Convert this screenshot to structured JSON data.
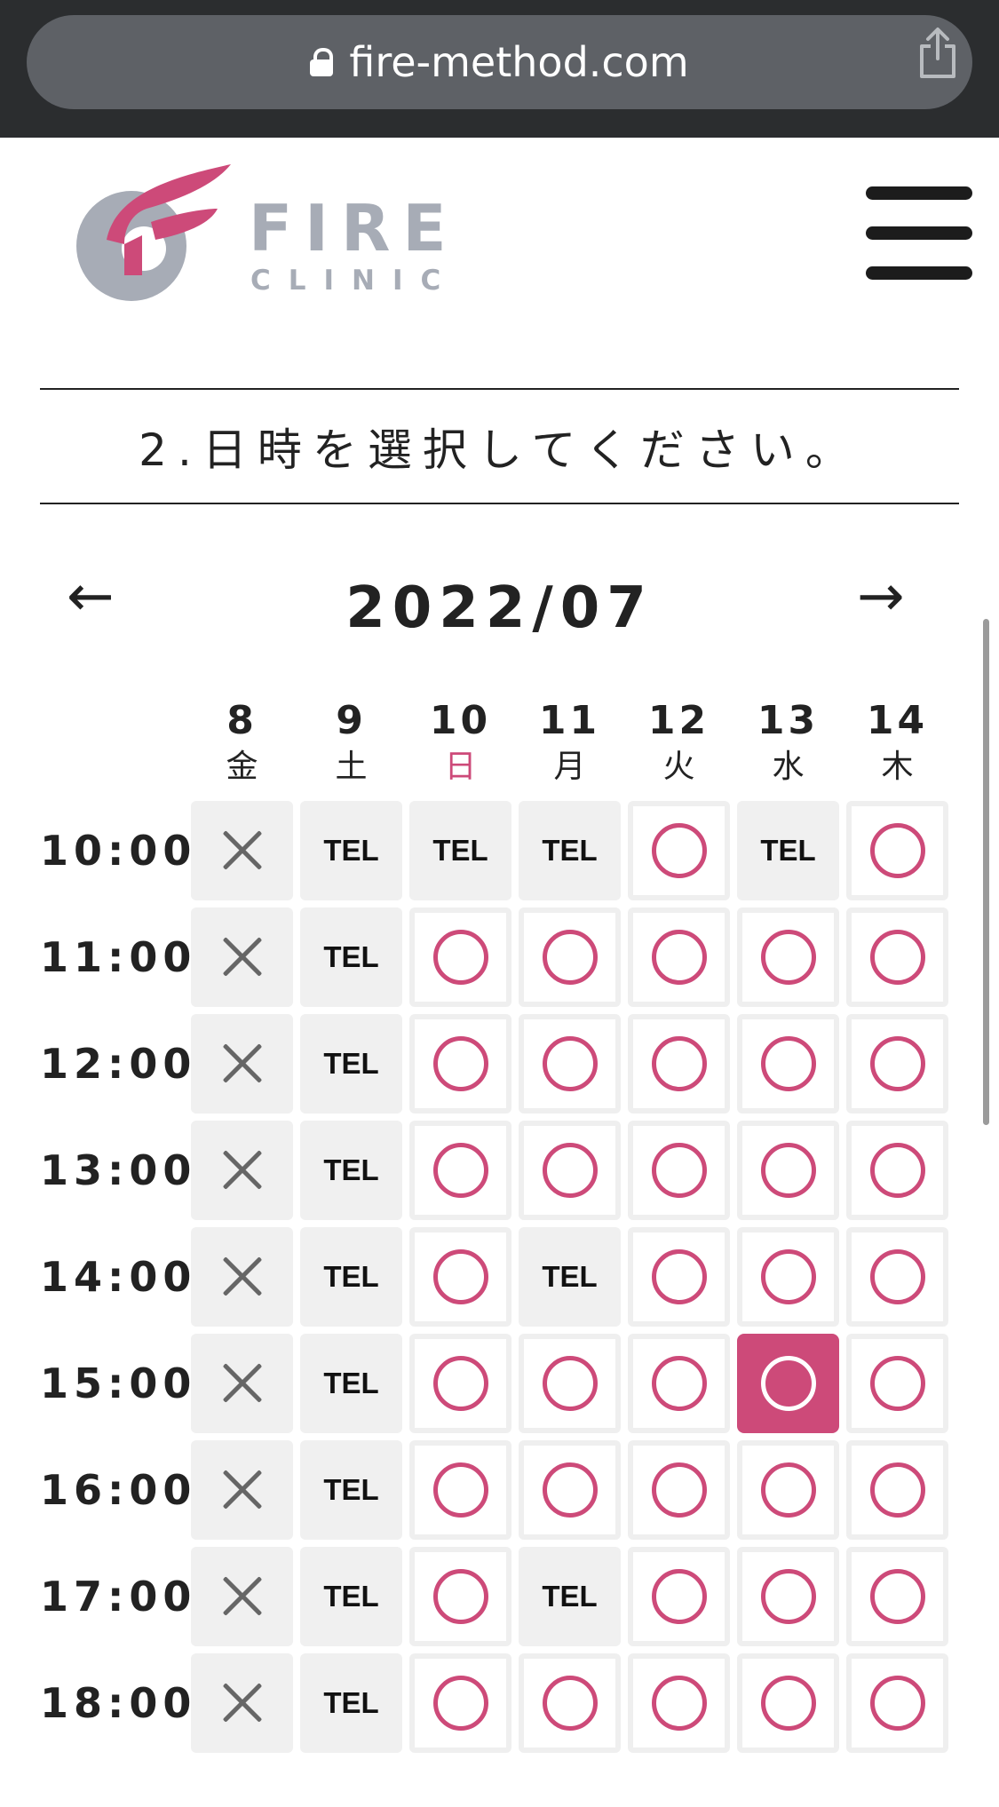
{
  "browser": {
    "url": "fire-method.com"
  },
  "logo": {
    "line1": "FIRE",
    "line2": "CLINIC",
    "brand_color": "#cd4a79",
    "gray_color": "#a7acb6"
  },
  "section": {
    "title": "2.日時を選択してください。"
  },
  "calendar": {
    "month": "2022/07",
    "prev_label": "←",
    "next_label": "→",
    "days": [
      {
        "num": "8",
        "weekday": "金",
        "color": "#222222"
      },
      {
        "num": "9",
        "weekday": "土",
        "color": "#222222"
      },
      {
        "num": "10",
        "weekday": "日",
        "color": "#cd4a79"
      },
      {
        "num": "11",
        "weekday": "月",
        "color": "#222222"
      },
      {
        "num": "12",
        "weekday": "火",
        "color": "#222222"
      },
      {
        "num": "13",
        "weekday": "水",
        "color": "#222222"
      },
      {
        "num": "14",
        "weekday": "木",
        "color": "#222222"
      }
    ],
    "times": [
      "10:00",
      "11:00",
      "12:00",
      "13:00",
      "14:00",
      "15:00",
      "16:00",
      "17:00",
      "18:00"
    ],
    "tel_label": "TEL",
    "grid": [
      [
        "x",
        "tel",
        "tel",
        "tel",
        "o",
        "tel",
        "o"
      ],
      [
        "x",
        "tel",
        "o",
        "o",
        "o",
        "o",
        "o"
      ],
      [
        "x",
        "tel",
        "o",
        "o",
        "o",
        "o",
        "o"
      ],
      [
        "x",
        "tel",
        "o",
        "o",
        "o",
        "o",
        "o"
      ],
      [
        "x",
        "tel",
        "o",
        "tel",
        "o",
        "o",
        "o"
      ],
      [
        "x",
        "tel",
        "o",
        "o",
        "o",
        "sel",
        "o"
      ],
      [
        "x",
        "tel",
        "o",
        "o",
        "o",
        "o",
        "o"
      ],
      [
        "x",
        "tel",
        "o",
        "tel",
        "o",
        "o",
        "o"
      ],
      [
        "x",
        "tel",
        "o",
        "o",
        "o",
        "o",
        "o"
      ]
    ]
  }
}
